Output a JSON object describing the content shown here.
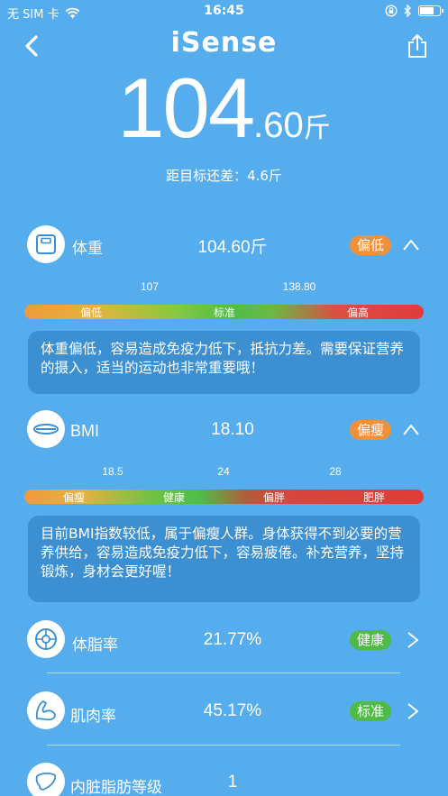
{
  "status_bar": {
    "carrier": "无 SIM 卡",
    "time": "16:45",
    "battery_level": 0.72
  },
  "header": {
    "brand": "iSense",
    "weight_int": "104",
    "weight_dec": ".60",
    "weight_unit": "斤",
    "target_diff": "距目标还差：4.6斤"
  },
  "weight_row": {
    "label": "体重",
    "value": "104.60斤",
    "badge": "偏低",
    "ticks": [
      "107",
      "138.80"
    ],
    "segments": [
      "偏低",
      "标准",
      "偏高"
    ],
    "tip": "体重偏低，容易造成免疫力低下，抵抗力差。需要保证营养的摄入，适当的运动也非常重要哦！"
  },
  "bmi_row": {
    "label": "BMI",
    "value": "18.10",
    "badge": "偏瘦",
    "ticks": [
      "18.5",
      "24",
      "28"
    ],
    "segments": [
      "偏瘦",
      "健康",
      "偏胖",
      "肥胖"
    ],
    "tip": "目前BMI指数较低，属于偏瘦人群。身体获得不到必要的营养供给，容易造成免疫力低下，容易疲倦。补充营养，坚持锻炼，身材会更好喔！"
  },
  "fat_row": {
    "label": "体脂率",
    "value": "21.77%",
    "badge": "健康"
  },
  "muscle_row": {
    "label": "肌肉率",
    "value": "45.17%",
    "badge": "标准"
  },
  "visceral_row": {
    "label": "内脏脂肪等级",
    "value": "1"
  },
  "colors": {
    "background": "#56adee",
    "tip_background": "#3c8fd0",
    "badge_orange": "#f0913a",
    "badge_green": "#4fba46",
    "icon_blue": "#3c8fd0"
  },
  "icons": [
    "back-chevron-icon",
    "share-icon",
    "scale-icon",
    "bmi-tape-icon",
    "body-fat-icon",
    "muscle-arm-icon",
    "liver-icon",
    "chevron-up-icon",
    "chevron-right-icon",
    "wifi-icon",
    "bluetooth-icon",
    "lock-rotation-icon"
  ]
}
